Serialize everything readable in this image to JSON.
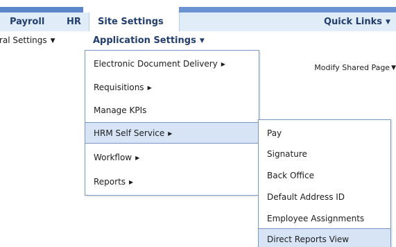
{
  "nav_top": {
    "payroll": "Payroll",
    "hr": "HR",
    "site_settings": "Site Settings",
    "quick_links": "Quick Links"
  },
  "nav_sub": {
    "general_settings": "ral Settings",
    "application_settings": "Application Settings"
  },
  "modify_shared_page": "Modify Shared Page",
  "menu_application_settings": {
    "items": [
      {
        "label": "Electronic Document Delivery",
        "has_submenu": true
      },
      {
        "label": "Requisitions",
        "has_submenu": true
      },
      {
        "label": "Manage KPIs",
        "has_submenu": false
      },
      {
        "label": "HRM Self Service",
        "has_submenu": true,
        "highlighted": true
      },
      {
        "label": "Workflow",
        "has_submenu": true
      },
      {
        "label": "Reports",
        "has_submenu": true
      }
    ]
  },
  "menu_hrm_self_service": {
    "items": [
      {
        "label": "Pay"
      },
      {
        "label": "Signature"
      },
      {
        "label": "Back Office"
      },
      {
        "label": "Default Address ID"
      },
      {
        "label": "Employee Assignments"
      },
      {
        "label": "Direct Reports View",
        "highlighted": true
      }
    ]
  },
  "colors": {
    "nav_bar_bg": "#e1ecf9",
    "nav_text": "#213e6e",
    "accent_blue": "#5b86c9",
    "menu_border": "#7a96c4",
    "highlight_bg": "#d6e4f6"
  },
  "icons": {
    "dropdown_caret": "caret-down-icon",
    "submenu_arrow": "caret-right-icon"
  }
}
